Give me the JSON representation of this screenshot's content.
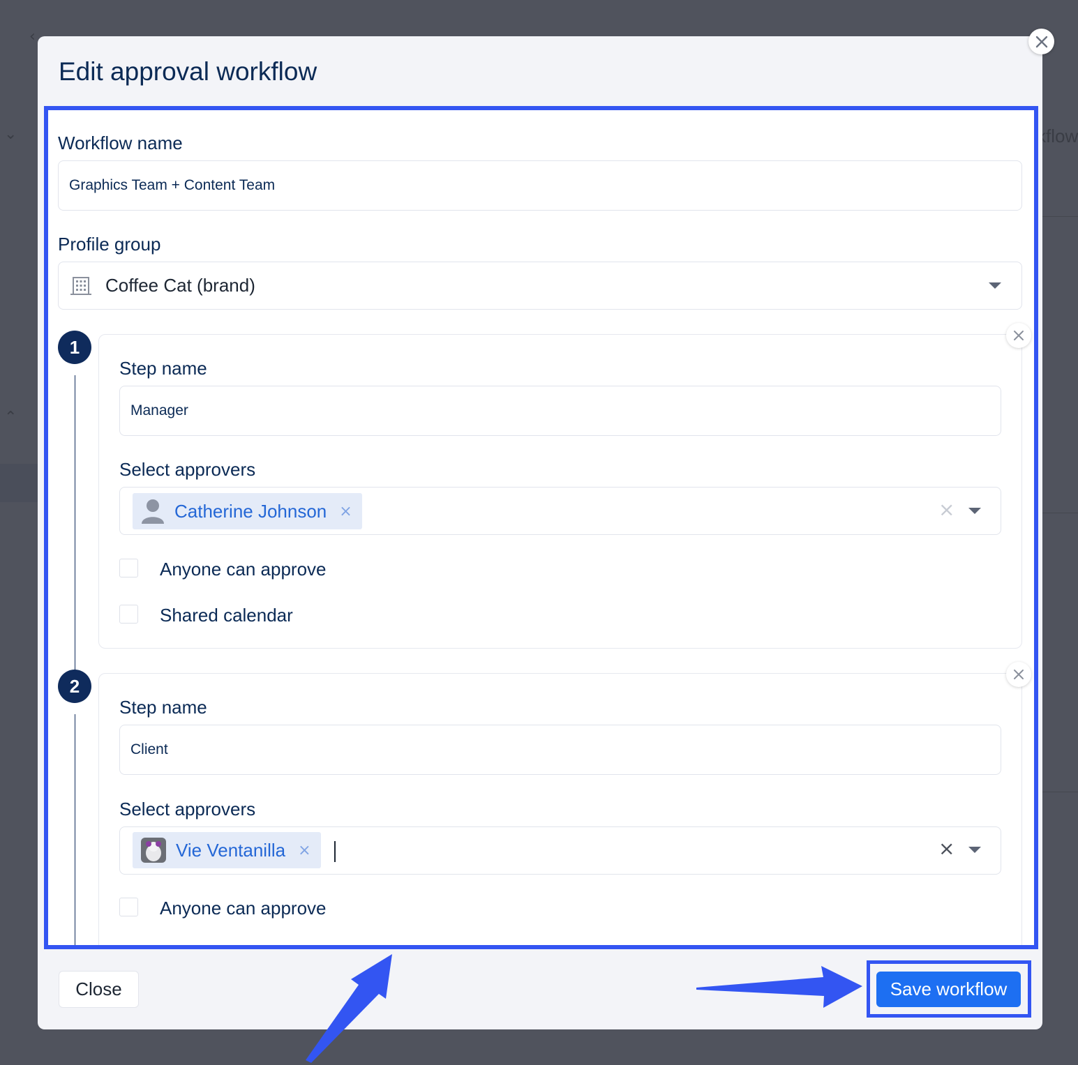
{
  "background": {
    "partial_text": "kflow"
  },
  "modal": {
    "title": "Edit approval workflow",
    "workflow_name_label": "Workflow name",
    "workflow_name_value": "Graphics Team + Content Team",
    "profile_group_label": "Profile group",
    "profile_group_value": "Coffee Cat (brand)"
  },
  "steps": [
    {
      "number": "1",
      "step_name_label": "Step name",
      "step_name_value": "Manager",
      "approvers_label": "Select approvers",
      "approver": "Catherine Johnson",
      "anyone_label": "Anyone can approve",
      "shared_label": "Shared calendar"
    },
    {
      "number": "2",
      "step_name_label": "Step name",
      "step_name_value": "Client",
      "approvers_label": "Select approvers",
      "approver": "Vie Ventanilla",
      "anyone_label": "Anyone can approve"
    }
  ],
  "footer": {
    "close_label": "Close",
    "save_label": "Save workflow"
  },
  "colors": {
    "highlight": "#3355f2",
    "primary_button": "#1d6ff2",
    "navy": "#0f2b5c"
  },
  "icons": {
    "building": "building-icon",
    "user": "user-icon",
    "close": "close-icon"
  }
}
